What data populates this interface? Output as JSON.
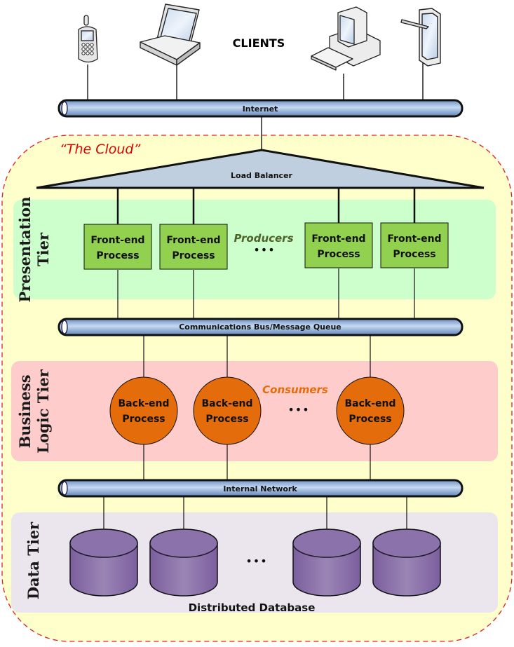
{
  "title": "CLIENTS",
  "clients": [
    {
      "type": "cell-phone"
    },
    {
      "type": "laptop"
    },
    {
      "type": "desktop-computer"
    },
    {
      "type": "tablet"
    }
  ],
  "networks": {
    "internet": "Internet",
    "message_bus": "Communications Bus/Message Queue",
    "internal": "Internal Network"
  },
  "cloud_label": "“The Cloud”",
  "load_balancer": "Load Balancer",
  "tiers": {
    "presentation": {
      "line1": "Presentation",
      "line2": "Tier"
    },
    "business": {
      "line1": "Business",
      "line2": "Logic Tier"
    },
    "data": {
      "line1": "Data Tier"
    }
  },
  "producers": {
    "label": "Producers",
    "ellipsis": "•••",
    "items": [
      {
        "line1": "Front-end",
        "line2": "Process"
      },
      {
        "line1": "Front-end",
        "line2": "Process"
      },
      {
        "line1": "Front-end",
        "line2": "Process"
      },
      {
        "line1": "Front-end",
        "line2": "Process"
      }
    ]
  },
  "consumers": {
    "label": "Consumers",
    "ellipsis": "•••",
    "items": [
      {
        "line1": "Back-end",
        "line2": "Process"
      },
      {
        "line1": "Back-end",
        "line2": "Process"
      },
      {
        "line1": "Back-end",
        "line2": "Process"
      }
    ]
  },
  "database": {
    "label": "Distributed Database",
    "ellipsis": "•••",
    "node_count": 4
  },
  "colors": {
    "cloud_fill": "#ffffcc",
    "cloud_border": "#e02020",
    "cloud_label": "#e00000",
    "presentation_fill": "#ccffcc",
    "business_fill": "#ffcccc",
    "data_fill": "#ebe6ee",
    "front_end_fill": "#92d050",
    "back_end_fill": "#e46c0a",
    "database_fill": "#8064a2",
    "pipe_fill": "#95b3d7",
    "load_balancer_fill": "#c0cfe0",
    "producers_text": "#4f6228",
    "consumers_text": "#e46c0a"
  }
}
